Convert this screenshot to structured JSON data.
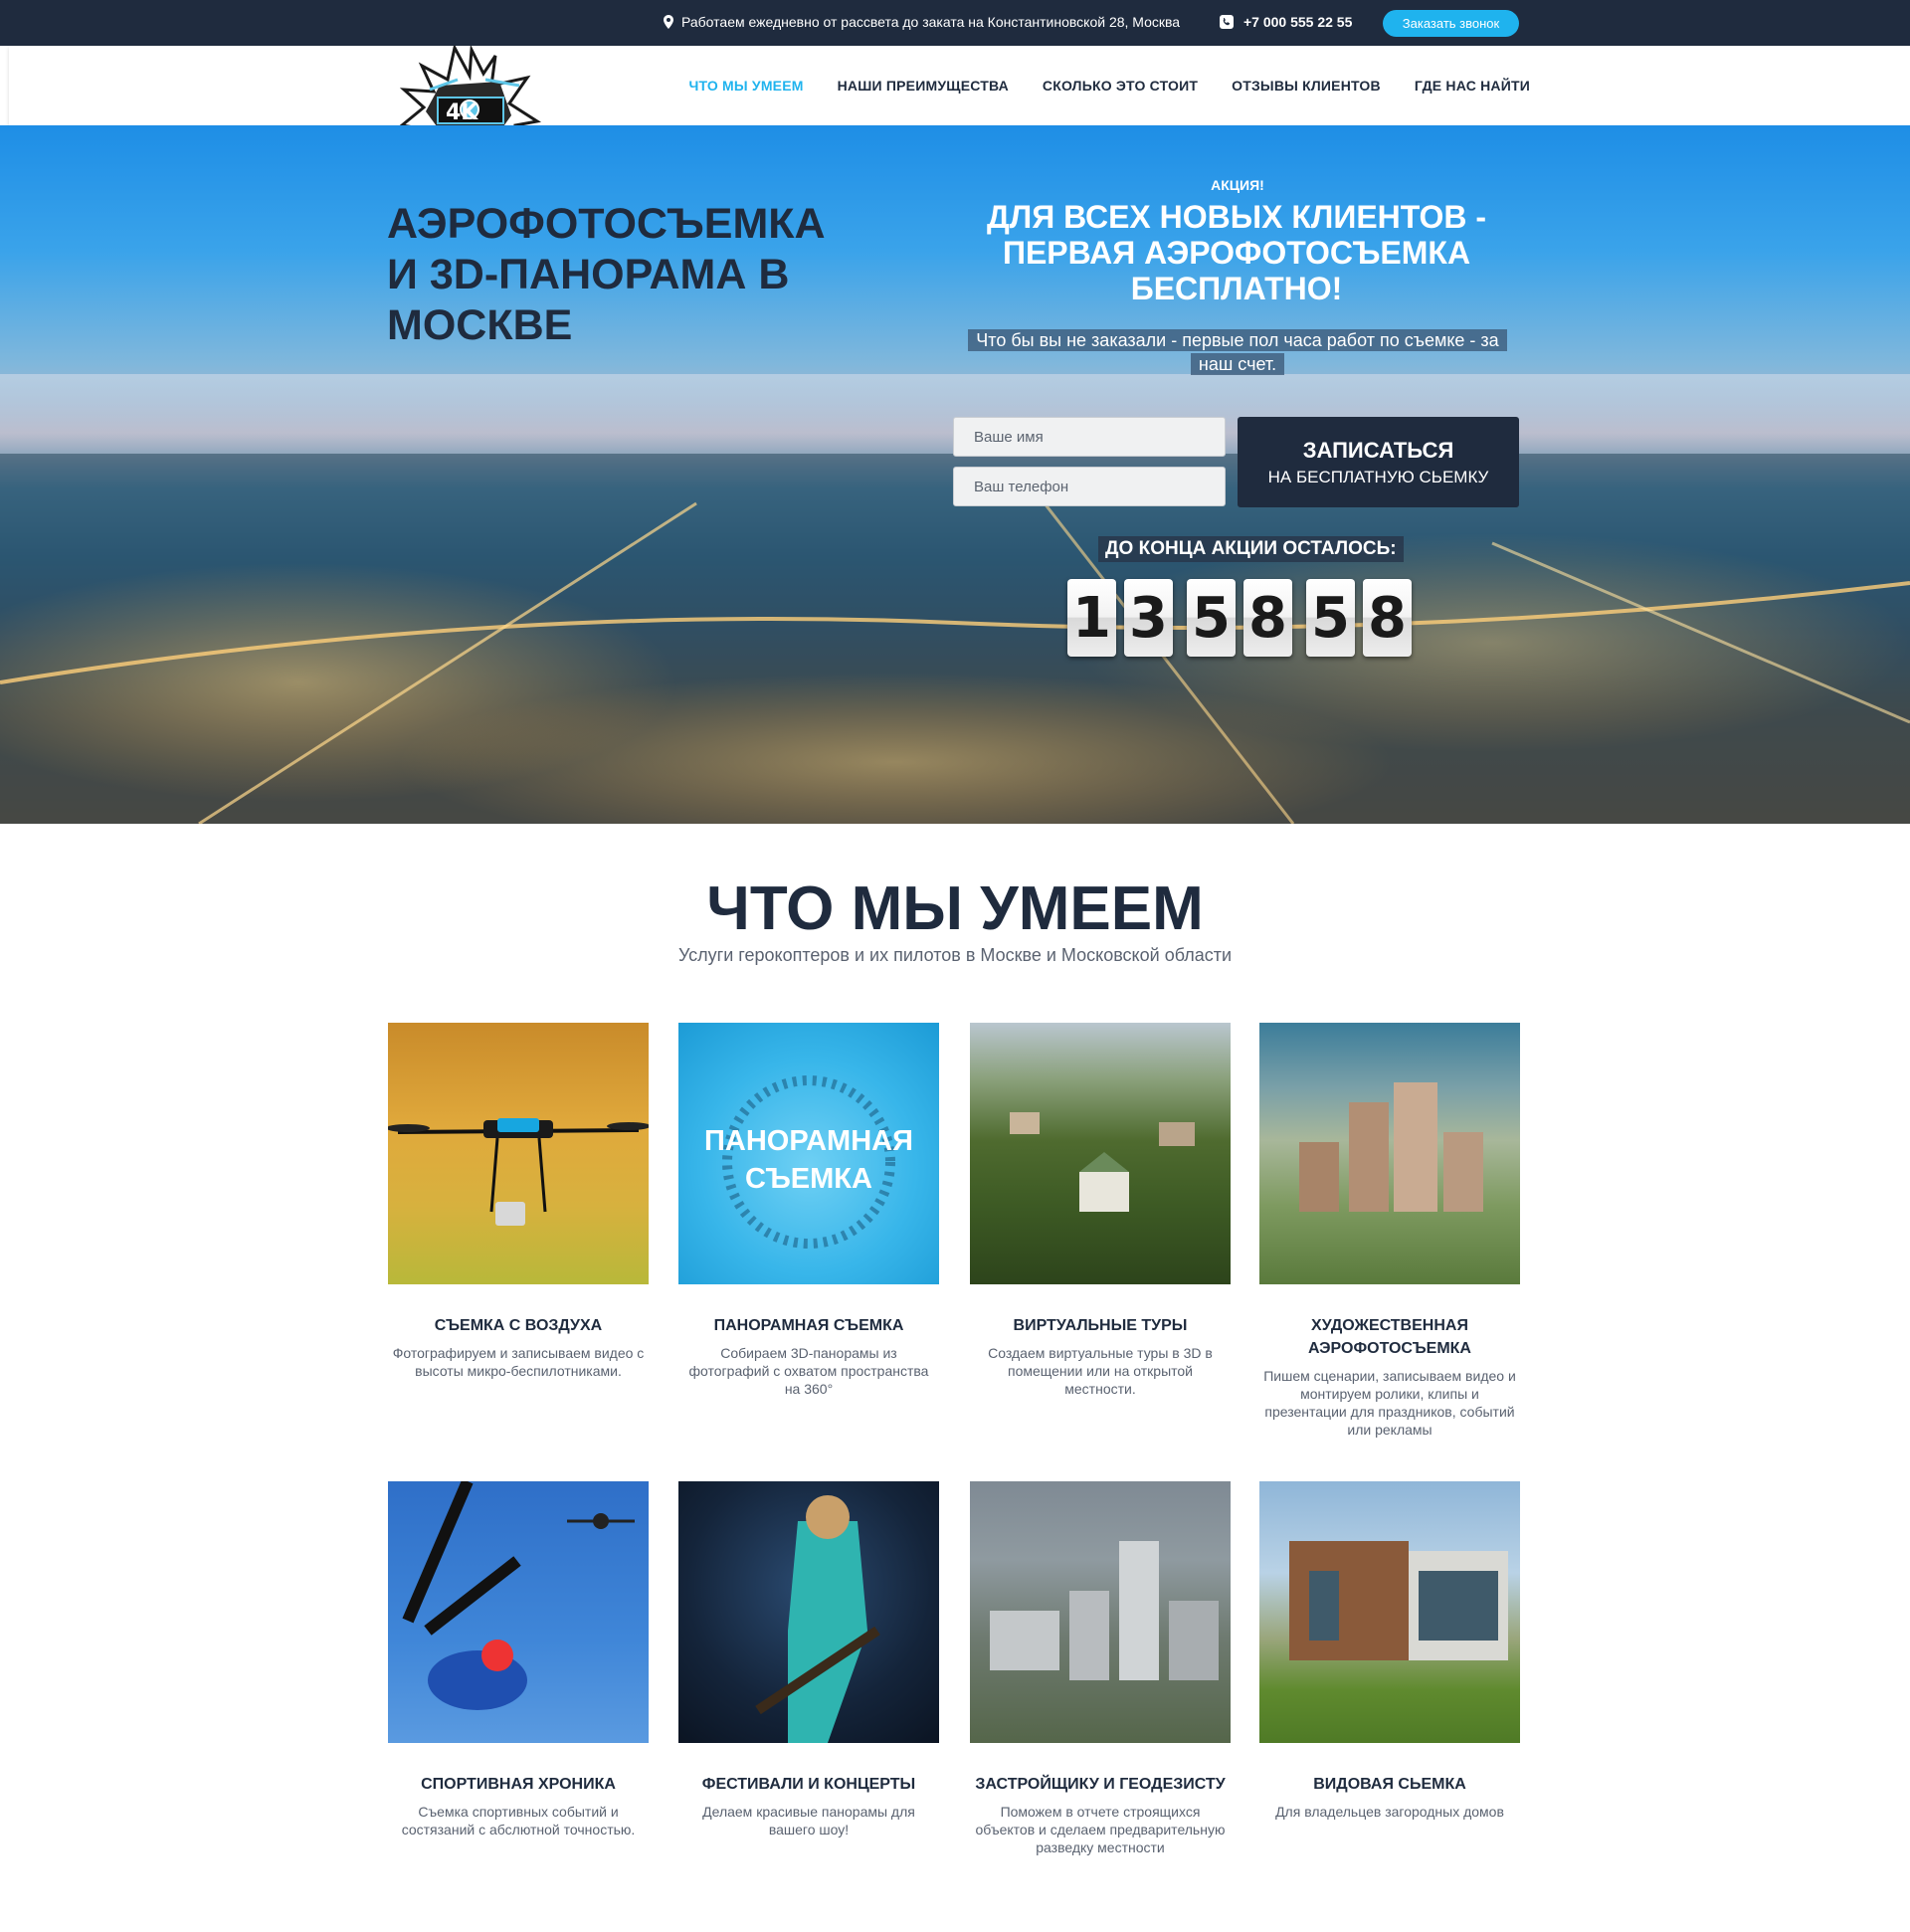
{
  "topbar": {
    "address": "Работаем ежедневно от рассвета до заката на Константиновской 28, Москва",
    "phone": "+7 000 555 22 55",
    "callback_label": "Заказать звонок"
  },
  "nav": {
    "items": [
      {
        "label": "ЧТО МЫ УМЕЕМ",
        "active": true
      },
      {
        "label": "НАШИ ПРЕИМУЩЕСТВА"
      },
      {
        "label": "СКОЛЬКО ЭТО СТОИТ"
      },
      {
        "label": "ОТЗЫВЫ КЛИЕНТОВ"
      },
      {
        "label": "ГДЕ НАС НАЙТИ"
      }
    ]
  },
  "hero": {
    "title": "АЭРОФОТОСЪЕМКА И 3D-ПАНОРАМА В МОСКВЕ",
    "promo_label": "АКЦИЯ!",
    "promo_title": "ДЛЯ ВСЕХ НОВЫХ КЛИЕНТОВ - ПЕРВАЯ АЭРОФОТОСЪЕМКА БЕСПЛАТНО!",
    "promo_sub": "Что бы вы не заказали - первые пол часа работ по съемке - за наш счет.",
    "name_placeholder": "Ваше имя",
    "phone_placeholder": "Ваш телефон",
    "submit_line1": "ЗАПИСАТЬСЯ",
    "submit_line2": "НА БЕСПЛАТНУЮ СЬЕМКУ",
    "countdown_label": "ДО КОНЦА АКЦИИ ОСТАЛОСЬ:",
    "countdown_digits": [
      "1",
      "3",
      "5",
      "8",
      "5",
      "8"
    ]
  },
  "services": {
    "title": "ЧТО МЫ УМЕЕМ",
    "subtitle": "Услуги герокоптеров и их пилотов в Москве и Московской области",
    "panorama_image_text": "ПАНОРАМНАЯ СЪЕМКА",
    "items": [
      {
        "title": "СЪЕМКА С ВОЗДУХА",
        "desc": "Фотографируем и записываем видео с высоты микро-беспилотниками."
      },
      {
        "title": "ПАНОРАМНАЯ СЪЕМКА",
        "desc": "Собираем 3D-панорамы из фотографий с охватом пространства на 360°"
      },
      {
        "title": "ВИРТУАЛЬНЫЕ ТУРЫ",
        "desc": "Создаем виртуальные туры в 3D в помещении или на открытой местности."
      },
      {
        "title": "ХУДОЖЕСТВЕННАЯ АЭРОФОТОСЪЕМКА",
        "desc": "Пишем сценарии, записываем видео и монтируем ролики, клипы и презентации для праздников, событий или рекламы"
      },
      {
        "title": "СПОРТИВНАЯ ХРОНИКА",
        "desc": "Съемка спортивных событий и состязаний с абслютной точностью."
      },
      {
        "title": "ФЕСТИВАЛИ И КОНЦЕРТЫ",
        "desc": "Делаем красивые панорамы для вашего шоу!"
      },
      {
        "title": "ЗАСТРОЙЩИКУ И ГЕОДЕЗИСТУ",
        "desc": "Поможем в отчете строящихся объектов и сделаем предварительную разведку местности"
      },
      {
        "title": "ВИДОВАЯ СЬЕМКА",
        "desc": "Для владельцев загородных домов"
      }
    ]
  },
  "colors": {
    "accent": "#1fb3ee",
    "dark": "#1f2b3e"
  }
}
